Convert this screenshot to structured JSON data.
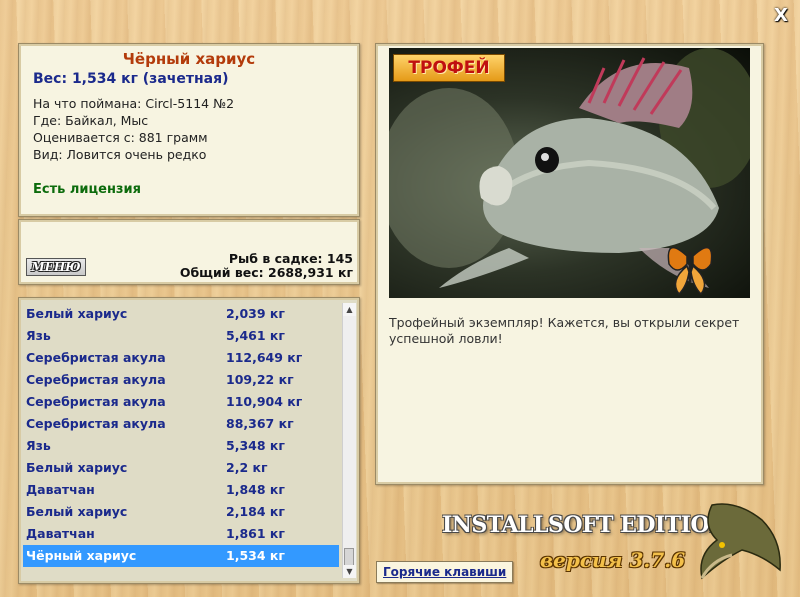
{
  "window": {
    "close_icon": "close-icon",
    "close_label": "X"
  },
  "fish": {
    "title": "Чёрный хариус",
    "weight": "Вес: 1,534 кг (зачетная)",
    "bait": "На что поймана: Circl-5114 №2",
    "place": "Где: Байкал, Мыс",
    "rated": "Оценивается с: 881 грамм",
    "kind": "Вид: Ловится очень редко",
    "license": "Есть лицензия"
  },
  "summary": {
    "menu_label": "МЕНЮ",
    "count": "Рыб в садке: 145",
    "total": "Общий вес: 2688,931 кг"
  },
  "catch_list": [
    {
      "name": "Белый хариус",
      "weight": "2,039 кг"
    },
    {
      "name": "Язь",
      "weight": "5,461 кг"
    },
    {
      "name": "Серебристая акула",
      "weight": "112,649 кг"
    },
    {
      "name": "Серебристая акула",
      "weight": "109,22 кг"
    },
    {
      "name": "Серебристая акула",
      "weight": "110,904 кг"
    },
    {
      "name": "Серебристая акула",
      "weight": "88,367 кг"
    },
    {
      "name": "Язь",
      "weight": "5,348 кг"
    },
    {
      "name": "Белый хариус",
      "weight": "2,2 кг"
    },
    {
      "name": "Даватчан",
      "weight": "1,848 кг"
    },
    {
      "name": "Белый хариус",
      "weight": "2,184 кг"
    },
    {
      "name": "Даватчан",
      "weight": "1,861 кг"
    },
    {
      "name": "Чёрный хариус",
      "weight": "1,534 кг",
      "selected": true
    }
  ],
  "photo": {
    "badge": "ТРОФЕЙ",
    "caption": "Трофейный экземпляр! Кажется, вы открыли секрет успешной ловли!"
  },
  "footer": {
    "brand": "INSTALLSOFT EDITION",
    "version": "версия 3.7.6",
    "hotkeys": "Горячие клавиши"
  },
  "colors": {
    "title": "#b33b0b",
    "weight": "#1b2a8c",
    "license": "#0c6b0c",
    "selection": "#3399ff"
  }
}
